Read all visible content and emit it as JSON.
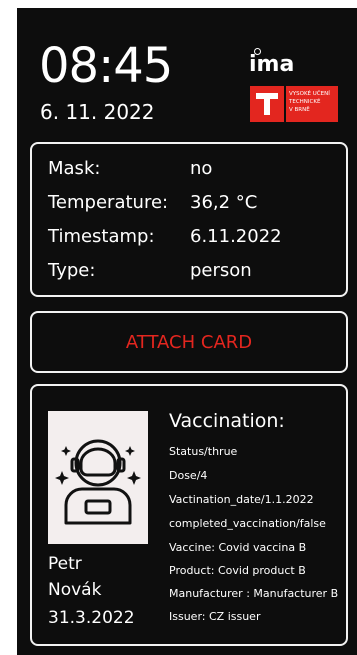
{
  "header": {
    "time": "08:45",
    "date": "6. 11. 2022",
    "brand": "ima",
    "university_lines": [
      "VYSOKÉ UČENÍ",
      "TECHNICKÉ",
      "V BRNĚ"
    ]
  },
  "info": {
    "rows": [
      {
        "label": "Mask:",
        "value": "no"
      },
      {
        "label": "Temperature:",
        "value": "36,2 °C"
      },
      {
        "label": "Timestamp:",
        "value": "6.11.2022"
      },
      {
        "label": "Type:",
        "value": "person"
      }
    ]
  },
  "attach": {
    "label": "ATTACH CARD"
  },
  "person": {
    "first_name": "Petr",
    "last_name": "Novák",
    "date": "31.3.2022"
  },
  "vaccination": {
    "title": "Vaccination:",
    "lines": [
      "Status/thrue",
      "Dose/4",
      "Vactination_date/1.1.2022",
      "completed_vaccination/false",
      "Vaccine: Covid vaccina B",
      "Product: Covid product B",
      "Manufacturer : Manufacturer B",
      "Issuer: CZ issuer"
    ]
  },
  "colors": {
    "accent": "#e3261f",
    "background": "#0d0d0d",
    "border": "#f2f2f2"
  },
  "icons": {
    "avatar": "astronaut-icon"
  }
}
